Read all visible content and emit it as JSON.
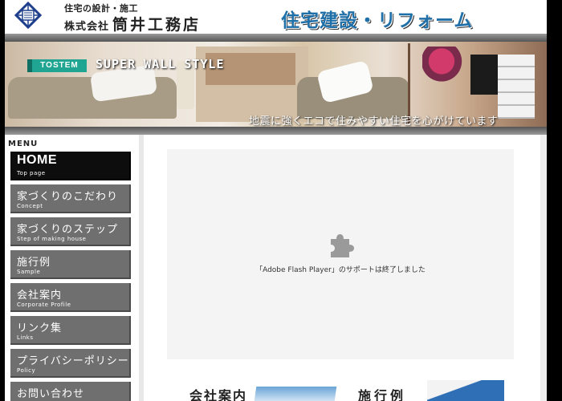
{
  "header": {
    "tagline": "住宅の設計・施工",
    "company_prefix": "株式会社",
    "company_name": "筒井工務店",
    "headline": "住宅建設・リフォーム"
  },
  "banner": {
    "brand": "TOSTEM",
    "style_name": "SUPER WALL STYLE",
    "slogan": "地震に強くエコで住みやすい住宅を心がけています"
  },
  "sidebar": {
    "title": "MENU",
    "items": [
      {
        "label": "HOME",
        "sub": "Top page"
      },
      {
        "label": "家づくりのこだわり",
        "sub": "Concept"
      },
      {
        "label": "家づくりのステップ",
        "sub": "Step of making house"
      },
      {
        "label": "施行例",
        "sub": "Sample"
      },
      {
        "label": "会社案内",
        "sub": "Corporate Profile"
      },
      {
        "label": "リンク集",
        "sub": "Links"
      },
      {
        "label": "プライバシーポリシー",
        "sub": "Policy"
      },
      {
        "label": "お問い合わせ",
        "sub": ""
      }
    ]
  },
  "main": {
    "flash_message": "「Adobe Flash Player」のサポートは終了しました",
    "promos": [
      {
        "label": "会社案内"
      },
      {
        "label": "施行例"
      }
    ]
  },
  "colors": {
    "accent_blue": "#1f6fa8",
    "brand_teal": "#1fa592",
    "nav_gray": "#6f6f6f",
    "nav_active": "#0d0d0d"
  },
  "icons": [
    "company-logo-icon",
    "puzzle-plugin-icon"
  ]
}
